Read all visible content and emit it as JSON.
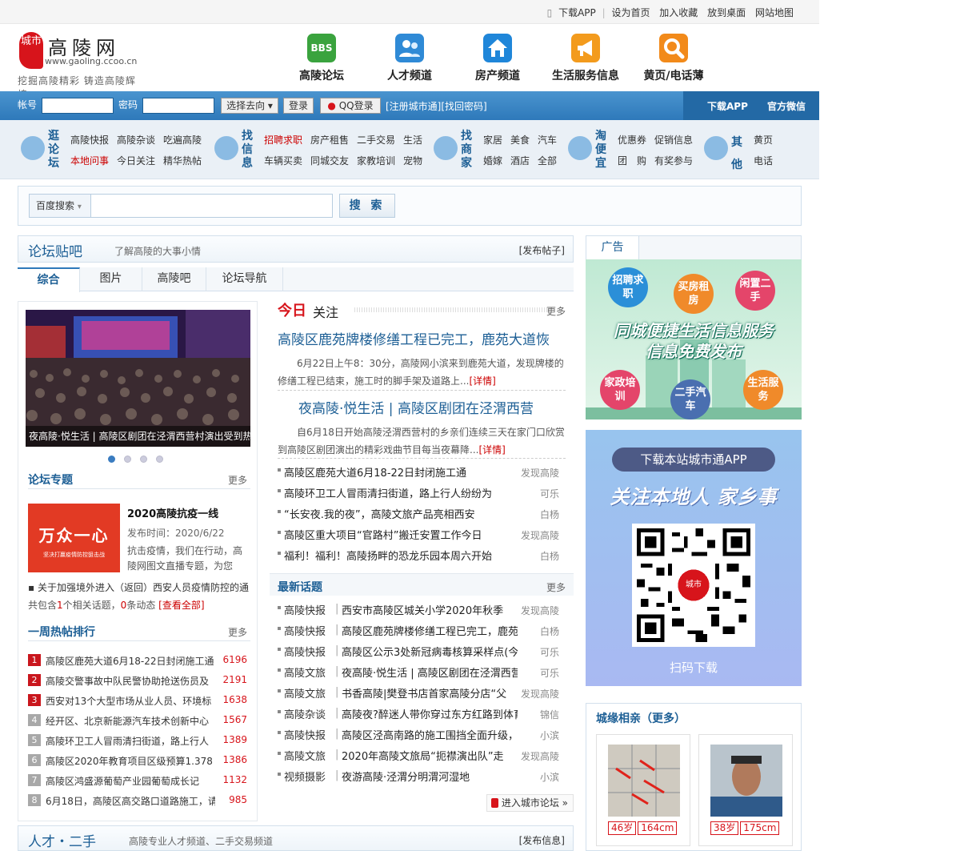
{
  "topbar": {
    "links": [
      "下载APP",
      "设为首页",
      "加入收藏",
      "放到桌面",
      "网站地图"
    ]
  },
  "logo": {
    "mark": "城市",
    "name": "高陵网",
    "url": "www.gaoling.ccoo.cn",
    "slogan": "挖掘高陵精彩 铸造高陵辉煌"
  },
  "mainnav": [
    {
      "label": "高陵论坛",
      "icon": "bbs-icon",
      "color": "#3aa33e",
      "glyph": "BBS"
    },
    {
      "label": "人才频道",
      "icon": "people-icon",
      "color": "#2f8ad6",
      "glyph": ""
    },
    {
      "label": "房产频道",
      "icon": "house-icon",
      "color": "#1f86d9",
      "glyph": ""
    },
    {
      "label": "生活服务信息",
      "icon": "megaphone-icon",
      "color": "#f39b1d",
      "glyph": ""
    },
    {
      "label": "黄页/电话薄",
      "icon": "magnifier-icon",
      "color": "#f28a1a",
      "glyph": ""
    }
  ],
  "login": {
    "account_label": "帐号",
    "password_label": "密码",
    "go_select": "选择去向",
    "login_button": "登录",
    "qq_login": "QQ登录",
    "register": "[注册城市通]",
    "find_password": "[找回密码]",
    "download_app": "下载APP",
    "wechat": "官方微信"
  },
  "catnav": [
    {
      "title": "逛论坛",
      "row1": [
        "高陵快报",
        "高陵杂谈",
        "吃遍高陵"
      ],
      "row2": [
        "本地问事",
        "今日关注",
        "精华热帖"
      ],
      "red": [
        "本地问事"
      ]
    },
    {
      "title": "找信息",
      "row1": [
        "招聘求职",
        "房产租售",
        "二手交易",
        "生活"
      ],
      "row2": [
        "车辆买卖",
        "同城交友",
        "家教培训",
        "宠物"
      ],
      "red": [
        "招聘求职"
      ]
    },
    {
      "title": "找商家",
      "row1": [
        "家居",
        "美食",
        "汽车"
      ],
      "row2": [
        "婚嫁",
        "酒店",
        "全部"
      ],
      "red": []
    },
    {
      "title": "淘便宜",
      "row1": [
        "优惠券",
        "促销信息"
      ],
      "row2": [
        "团　购",
        "有奖参与"
      ],
      "red": []
    },
    {
      "title": "其他",
      "row1": [
        "黄页"
      ],
      "row2": [
        "电话"
      ],
      "red": []
    }
  ],
  "search": {
    "engine": "百度搜索",
    "button": "搜 索",
    "value": ""
  },
  "forum": {
    "title": "论坛贴吧",
    "desc": "了解高陵的大事小情",
    "post": "[发布帖子]",
    "tabs": [
      "综合",
      "图片",
      "高陵吧",
      "论坛导航"
    ],
    "slide_caption": "夜高陵·悦生活 | 高陵区剧团在泾渭西营村演出受到热",
    "slide_dots": 4,
    "topic_head": "论坛专题",
    "more": "更多",
    "topic": {
      "img_big": "万众一心",
      "img_small": "坚决打赢疫情防控狙击战",
      "title": "2020高陵抗疫一线",
      "date": "发布时间：2020/6/22",
      "desc": "抗击疫情，我们在行动，高陵网图文直播专题，为您"
    },
    "topic_link": "关于加强境外进入（返回）西安人员疫情防控的通",
    "topic_sum": {
      "pre": "共包含",
      "a": "1",
      "mid": "个相关话题，",
      "b": "0",
      "post": "条动态",
      "all": "[查看全部]"
    },
    "hot_head": "一周热帖排行",
    "hot": [
      {
        "n": "1",
        "t": "高陵区鹿苑大道6月18-22日封闭施工通",
        "c": "6196"
      },
      {
        "n": "2",
        "t": "高陵交警事故中队民警协助抢送伤员及",
        "c": "2191"
      },
      {
        "n": "3",
        "t": "西安对13个大型市场从业人员、环境标",
        "c": "1638"
      },
      {
        "n": "4",
        "t": "经开区、北京新能源汽车技术创新中心",
        "c": "1567"
      },
      {
        "n": "5",
        "t": "高陵环卫工人冒雨清扫街道，路上行人",
        "c": "1389"
      },
      {
        "n": "6",
        "t": "高陵区2020年教育项目区级预算1.378",
        "c": "1386"
      },
      {
        "n": "7",
        "t": "高陵区鸿盛源葡萄产业园葡萄成长记",
        "c": "1132"
      },
      {
        "n": "8",
        "t": "6月18日，高陵区高交路口道路施工，请",
        "c": "985"
      }
    ]
  },
  "today": {
    "a": "今日",
    "b": "关注",
    "more": "更多",
    "lead1": {
      "h": "高陵区鹿苑牌楼修缮工程已完工，鹿苑大道恢",
      "p": "6月22日上午8：30分，高陵网小滨来到鹿苑大道，发现牌楼的修缮工程已结束，施工时的脚手架及道路上...",
      "dl": "[详情]"
    },
    "lead2": {
      "h": "夜高陵·悦生活 | 高陵区剧团在泾渭西营",
      "p": "自6月18日开始高陵泾渭西营村的乡亲们连续三天在家门口欣赏到高陵区剧团演出的精彩戏曲节目每当夜幕降...",
      "dl": "[详情]"
    },
    "news": [
      {
        "t": "高陵区鹿苑大道6月18-22日封闭施工通",
        "s": "发现高陵"
      },
      {
        "t": "高陵环卫工人冒雨清扫街道，路上行人纷纷为",
        "s": "可乐"
      },
      {
        "t": "“长安夜.我的夜”，高陵文旅产品亮相西安",
        "s": "白杨"
      },
      {
        "t": "高陵区重大项目“官路村”搬迁安置工作今日",
        "s": "发现高陵"
      },
      {
        "t": "福利！福利！高陵扬畔的恐龙乐园本周六开始",
        "s": "白杨"
      }
    ],
    "new_head": "最新话题",
    "newtopics": [
      {
        "c": "高陵快报",
        "t": "西安市高陵区城关小学2020年秋季",
        "s": "发现高陵"
      },
      {
        "c": "高陵快报",
        "t": "高陵区鹿苑牌楼修缮工程已完工，鹿苑",
        "s": "白杨"
      },
      {
        "c": "高陵快报",
        "t": "高陵区公示3处新冠病毒核算采样点(今)",
        "s": "可乐"
      },
      {
        "c": "高陵文旅",
        "t": "夜高陵·悦生活 | 高陵区剧团在泾渭西营",
        "s": "可乐"
      },
      {
        "c": "高陵文旅",
        "t": "书香高陵|樊登书店首家高陵分店“父",
        "s": "发现高陵"
      },
      {
        "c": "高陵杂谈",
        "t": "高陵夜?醉迷人带你穿过东方红路到体育",
        "s": "锦信"
      },
      {
        "c": "高陵快报",
        "t": "高陵区泾高南路的施工围挡全面升级，",
        "s": "小滨"
      },
      {
        "c": "高陵文旅",
        "t": "2020年高陵文旅局“扼襟演出队”走",
        "s": "发现高陵"
      },
      {
        "c": "视频摄影",
        "t": "夜游高陵·泾渭分明渭河湿地",
        "s": "小滨"
      }
    ],
    "enter": "进入城市论坛 »"
  },
  "ads": {
    "title": "广告",
    "ad1": {
      "bubbles": [
        "招聘求职",
        "买房租房",
        "闲置二手",
        "家政培训",
        "二手汽车",
        "生活服务"
      ],
      "slogan1": "同城便捷生活信息服务",
      "slogan2": "信息免费发布"
    },
    "ad2": {
      "pill": "下载本站城市通APP",
      "big": "关注本地人 家乡事",
      "qr_mark": "城市",
      "qrtxt": "扫码下载"
    }
  },
  "match": {
    "title": "城缘相亲（更多）",
    "cards": [
      {
        "age": "46岁",
        "height": "164cm"
      },
      {
        "age": "38岁",
        "height": "175cm"
      }
    ]
  },
  "bottom": {
    "title": "人才・二手",
    "desc": "高陵专业人才频道、二手交易频道",
    "post": "[发布信息]"
  }
}
